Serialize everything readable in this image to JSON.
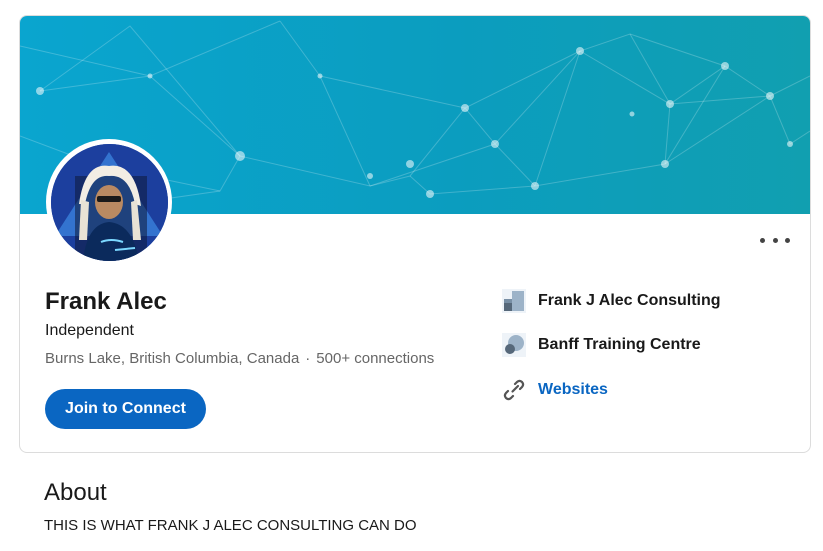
{
  "profile": {
    "name": "Frank Alec",
    "headline": "Independent",
    "location": "Burns Lake, British Columbia, Canada",
    "separator": "·",
    "connections": "500+ connections",
    "join_label": "Join to Connect"
  },
  "sidebar": {
    "items": [
      {
        "label": "Frank J Alec Consulting",
        "icon": "company-logo-icon"
      },
      {
        "label": "Banff Training Centre",
        "icon": "school-logo-icon"
      },
      {
        "label": "Websites",
        "icon": "link-icon"
      }
    ]
  },
  "about": {
    "title": "About",
    "text": "THIS IS WHAT FRANK J ALEC CONSULTING CAN DO"
  },
  "colors": {
    "brand_blue": "#0a66c2",
    "banner_teal": "#0aa5cf"
  }
}
